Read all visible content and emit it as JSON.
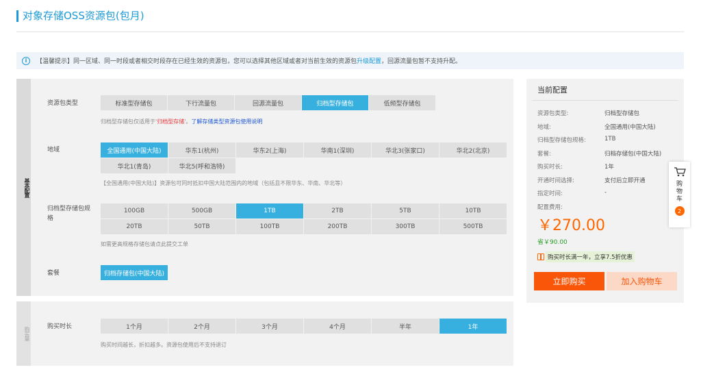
{
  "header": {
    "title": "对象存储OSS资源包(包月)"
  },
  "notice": {
    "text_before": "【温馨提示】同一区域、同一时段或者相交时段存在已经生效的资源包，您可以选择其他区域或者对当前生效的资源包",
    "link": "升级配置",
    "text_after": "，回源流量包暂不支持升配。"
  },
  "basic": {
    "side_label": "基本配置",
    "package_type": {
      "label": "资源包类型",
      "options": [
        "标准型存储包",
        "下行流量包",
        "回源流量包",
        "归档型存储包",
        "低频型存储包"
      ],
      "hint_before": "归档型存储包仅适用于'",
      "hint_red": "归档型存储",
      "hint_mid": "'。",
      "hint_link": "了解存储类型资源包使用说明"
    },
    "region": {
      "label": "地域",
      "options": [
        "全国通用(中国大陆)",
        "华东1(杭州)",
        "华东2(上海)",
        "华南1(深圳)",
        "华北3(张家口)",
        "华北2(北京)",
        "华北1(青岛)",
        "华北5(呼和浩特)"
      ],
      "hint": "【全国通用(中国大陆)】资源包可同时抵扣中国大陆范围内的地域（包括且不限华东、华南、华北等）"
    },
    "spec": {
      "label_line1": "归档型存储包规",
      "label_line2": "格",
      "options": [
        "100GB",
        "500GB",
        "1TB",
        "2TB",
        "5TB",
        "10TB",
        "20TB",
        "50TB",
        "100TB",
        "200TB",
        "300TB",
        "500TB"
      ],
      "hint": "如需更高规格存储包请点此提交工单"
    },
    "plan": {
      "label": "套餐",
      "options": [
        "归档存储包(中国大陆)"
      ]
    }
  },
  "purchase": {
    "side_label": "购买量",
    "duration": {
      "label": "购买时长",
      "options": [
        "1个月",
        "2个月",
        "3个月",
        "4个月",
        "半年",
        "1年"
      ],
      "hint": "购买时间越长，折扣越多。资源包使用后不支持退订"
    }
  },
  "summary": {
    "title": "当前配置",
    "rows": [
      {
        "k": "资源包类型:",
        "v": "归档型存储包"
      },
      {
        "k": "地域:",
        "v": "全国通用(中国大陆)"
      },
      {
        "k": "归档型存储包规格:",
        "v": "1TB"
      },
      {
        "k": "套餐:",
        "v": "归档存储包(中国大陆)"
      },
      {
        "k": "购买时长:",
        "v": "1年"
      },
      {
        "k": "开通时间选择:",
        "v": "支付后立即开通"
      },
      {
        "k": "指定时间:",
        "v": "-"
      },
      {
        "k": "配置费用:",
        "v": ""
      }
    ],
    "price": "￥270.00",
    "saved": "省￥90.00",
    "promo": "购买时长满一年，立享7.5折优惠",
    "buy_label": "立即购买",
    "cart_label": "加入购物车"
  },
  "float_cart": {
    "label": "购物车",
    "count": "2"
  },
  "colors": {
    "accent": "#37afdf",
    "title_blue": "#1d9ad6",
    "price_orange": "#f60",
    "buy_orange": "#f9560a"
  },
  "selected": {
    "package_type": 3,
    "region": 0,
    "spec": 2,
    "plan": 0,
    "duration": 5
  }
}
